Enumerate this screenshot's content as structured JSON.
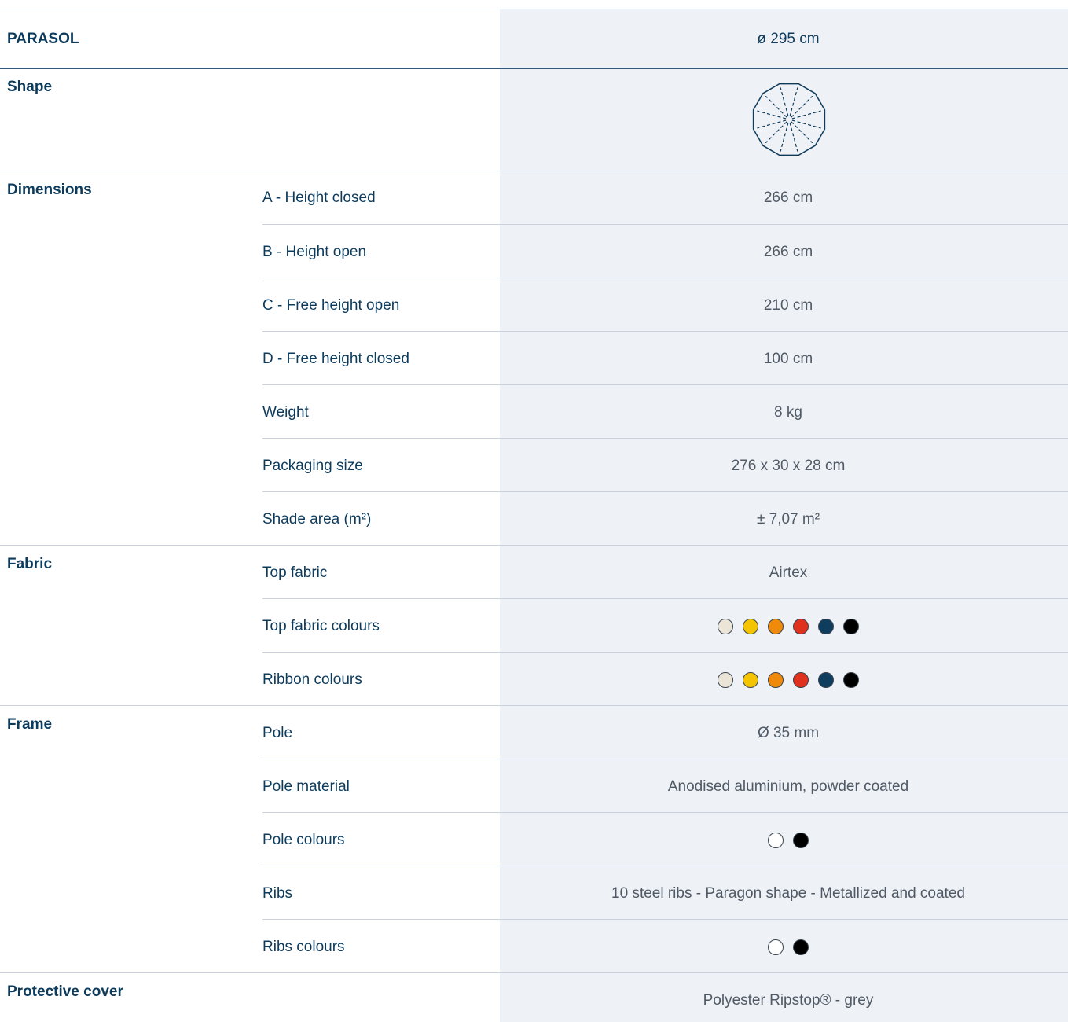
{
  "header": {
    "title": "PARASOL",
    "value": "ø 295 cm"
  },
  "shape": {
    "label": "Shape",
    "icon": "dodecagon-parasol-shape-icon"
  },
  "dimensions": {
    "label": "Dimensions",
    "rows": [
      {
        "label": "A - Height closed",
        "value": "266 cm"
      },
      {
        "label": "B - Height open",
        "value": "266 cm"
      },
      {
        "label": "C - Free height open",
        "value": "210 cm"
      },
      {
        "label": "D - Free height closed",
        "value": "100 cm"
      },
      {
        "label": "Weight",
        "value": "8 kg"
      },
      {
        "label": "Packaging size",
        "value": "276 x 30 x 28 cm"
      },
      {
        "label": "Shade area (m²)",
        "value": "± 7,07 m²"
      }
    ]
  },
  "fabric": {
    "label": "Fabric",
    "top_fabric": {
      "label": "Top fabric",
      "value": "Airtex"
    },
    "top_fabric_colours": {
      "label": "Top fabric colours",
      "colors": [
        "#ebe5d8",
        "#f5c400",
        "#ef8a0a",
        "#e0301e",
        "#0f3d5e",
        "#000000"
      ]
    },
    "ribbon_colours": {
      "label": "Ribbon colours",
      "colors": [
        "#ebe5d8",
        "#f5c400",
        "#ef8a0a",
        "#e0301e",
        "#0f3d5e",
        "#000000"
      ]
    }
  },
  "frame": {
    "label": "Frame",
    "pole": {
      "label": "Pole",
      "value": "Ø 35 mm"
    },
    "pole_material": {
      "label": "Pole material",
      "value": "Anodised aluminium, powder coated"
    },
    "pole_colours": {
      "label": "Pole colours",
      "colors": [
        "#ffffff",
        "#000000"
      ]
    },
    "ribs": {
      "label": "Ribs",
      "value": "10 steel ribs - Paragon shape - Metallized and coated"
    },
    "ribs_colours": {
      "label": "Ribs colours",
      "colors": [
        "#ffffff",
        "#000000"
      ]
    }
  },
  "protective_cover": {
    "label": "Protective cover",
    "value": "Polyester Ripstop® - grey"
  }
}
